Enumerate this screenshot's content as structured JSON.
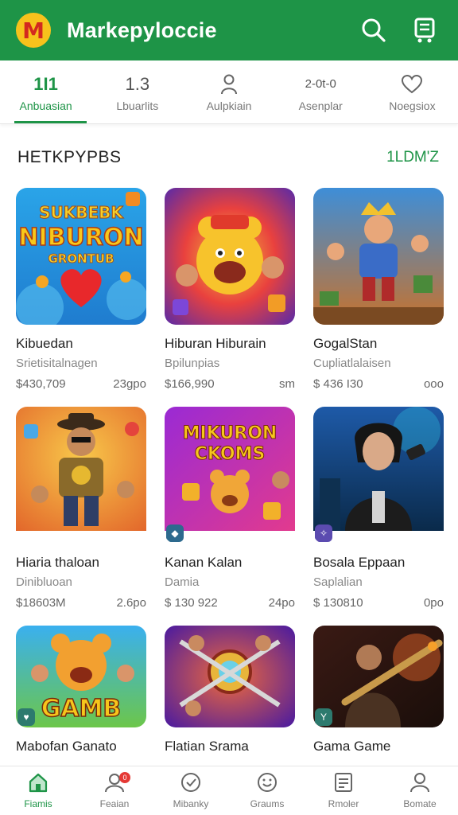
{
  "header": {
    "logo_letter": "M",
    "title": "Markepyloccie",
    "icons": [
      "search-icon",
      "cart-icon"
    ]
  },
  "tabs": [
    {
      "top": "1I1",
      "label": "Anbuasian",
      "active": true
    },
    {
      "top": "1.3",
      "label": "Lbuarlits",
      "active": false
    },
    {
      "top": "",
      "label": "Aulpkiain",
      "active": false,
      "icon": "user-icon"
    },
    {
      "top": "2-0t-0",
      "label": "Asenplar",
      "active": false
    },
    {
      "top": "",
      "label": "Noegsiox",
      "active": false,
      "icon": "heart-icon"
    }
  ],
  "section": {
    "title": "HETKPYPBS",
    "link": "1LDM'Z"
  },
  "cards": [
    {
      "title": "Kibuedan",
      "subtitle": "Srietisitalnagen",
      "price": "$430,709",
      "meta": "23gpo",
      "art_text": [
        "SUKBEBK",
        "NIBURON",
        "GRONTUB"
      ]
    },
    {
      "title": "Hiburan Hiburain",
      "subtitle": "Bpilunpias",
      "price": "$166,990",
      "meta": "sm"
    },
    {
      "title": "GogalStan",
      "subtitle": "Cupliatlalaisen",
      "price": "$ 436 I30",
      "meta": "ooo"
    },
    {
      "title": "Hiaria thaloan",
      "subtitle": "Dinibluoan",
      "price": "$18603M",
      "meta": "2.6po"
    },
    {
      "title": "Kanan Kalan",
      "subtitle": "Damia",
      "price": "$ 130 922",
      "meta": "24po",
      "art_text": [
        "MIKURON",
        "CKOMS"
      ]
    },
    {
      "title": "Bosala Eppaan",
      "subtitle": "Saplalian",
      "price": "$ 130810",
      "meta": "0po"
    },
    {
      "title": "Mabofan Ganato",
      "subtitle": "",
      "price": "",
      "meta": "",
      "art_text": [
        "GAMB"
      ]
    },
    {
      "title": "Flatian Srama",
      "subtitle": "",
      "price": "",
      "meta": ""
    },
    {
      "title": "Gama Game",
      "subtitle": "",
      "price": "",
      "meta": ""
    }
  ],
  "bottom_nav": [
    {
      "label": "Fiamis",
      "icon": "home-icon",
      "active": true
    },
    {
      "label": "Feaian",
      "icon": "profile-icon",
      "active": false,
      "badge": "0"
    },
    {
      "label": "Mibanky",
      "icon": "check-icon",
      "active": false
    },
    {
      "label": "Graums",
      "icon": "smile-icon",
      "active": false
    },
    {
      "label": "Rmoler",
      "icon": "list-icon",
      "active": false
    },
    {
      "label": "Bomate",
      "icon": "account-icon",
      "active": false
    }
  ],
  "colors": {
    "brand_green": "#1e9447",
    "logo_yellow": "#f7c21c",
    "logo_red": "#d3281f",
    "badge_red": "#e53935"
  }
}
